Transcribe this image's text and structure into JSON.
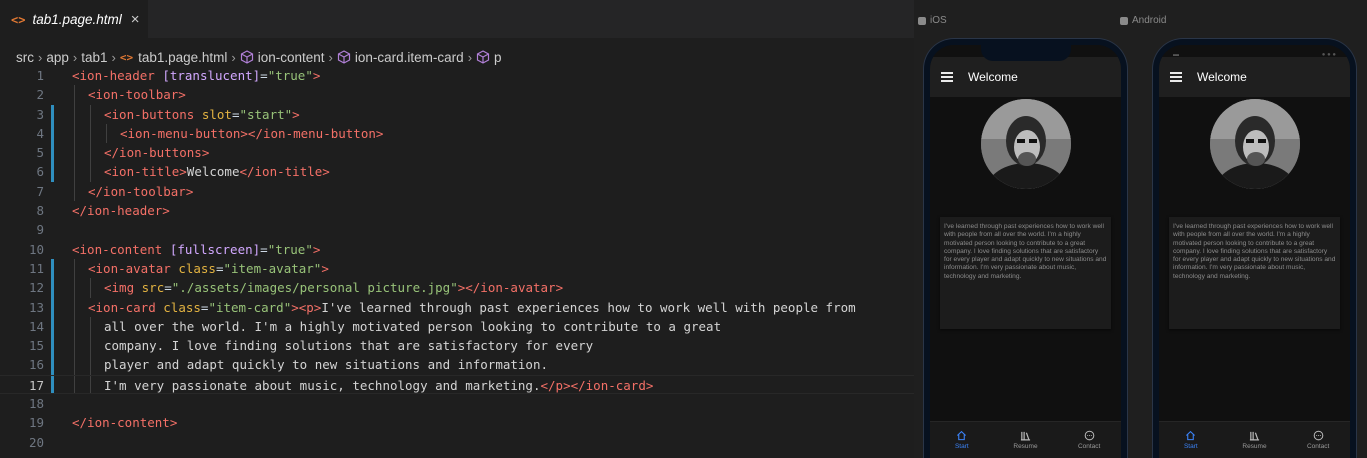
{
  "editor": {
    "tab": {
      "icon": "<>",
      "name": "tab1.page.html",
      "close": "×"
    },
    "breadcrumb": [
      "src",
      "app",
      "tab1",
      "tab1.page.html",
      "ion-content",
      "ion-card.item-card",
      "p"
    ],
    "current_line": 17,
    "lines": [
      {
        "n": "1",
        "indent": 0,
        "tokens": [
          [
            "tag",
            "<ion-header "
          ],
          [
            "attr",
            "[translucent]"
          ],
          [
            "punc",
            "="
          ],
          [
            "str",
            "\"true\""
          ],
          [
            "tag",
            ">"
          ]
        ]
      },
      {
        "n": "2",
        "indent": 1,
        "tokens": [
          [
            "tag",
            "<ion-toolbar>"
          ]
        ]
      },
      {
        "n": "3",
        "indent": 2,
        "tokens": [
          [
            "tag",
            "<ion-buttons "
          ],
          [
            "attr2",
            "slot"
          ],
          [
            "punc",
            "="
          ],
          [
            "str",
            "\"start\""
          ],
          [
            "tag",
            ">"
          ]
        ]
      },
      {
        "n": "4",
        "indent": 3,
        "tokens": [
          [
            "tag",
            "<ion-menu-button></ion-menu-button>"
          ]
        ]
      },
      {
        "n": "5",
        "indent": 2,
        "tokens": [
          [
            "tag",
            "</ion-buttons>"
          ]
        ]
      },
      {
        "n": "6",
        "indent": 2,
        "tokens": [
          [
            "tag",
            "<ion-title>"
          ],
          [
            "text",
            "Welcome"
          ],
          [
            "tag",
            "</ion-title>"
          ]
        ]
      },
      {
        "n": "7",
        "indent": 1,
        "tokens": [
          [
            "tag",
            "</ion-toolbar>"
          ]
        ]
      },
      {
        "n": "8",
        "indent": 0,
        "tokens": [
          [
            "tag",
            "</ion-header>"
          ]
        ]
      },
      {
        "n": "9",
        "indent": 0,
        "tokens": []
      },
      {
        "n": "10",
        "indent": 0,
        "tokens": [
          [
            "tag",
            "<ion-content "
          ],
          [
            "attr",
            "[fullscreen]"
          ],
          [
            "punc",
            "="
          ],
          [
            "str",
            "\"true\""
          ],
          [
            "tag",
            ">"
          ]
        ]
      },
      {
        "n": "11",
        "indent": 1,
        "tokens": [
          [
            "tag",
            "<ion-avatar "
          ],
          [
            "attr2",
            "class"
          ],
          [
            "punc",
            "="
          ],
          [
            "str",
            "\"item-avatar\""
          ],
          [
            "tag",
            ">"
          ]
        ]
      },
      {
        "n": "12",
        "indent": 2,
        "tokens": [
          [
            "tag",
            "<img "
          ],
          [
            "attr2",
            "src"
          ],
          [
            "punc",
            "="
          ],
          [
            "str",
            "\"./assets/images/personal picture.jpg\""
          ],
          [
            "tag",
            "></ion-avatar>"
          ]
        ]
      },
      {
        "n": "13",
        "indent": 1,
        "tokens": [
          [
            "tag",
            "<ion-card "
          ],
          [
            "attr2",
            "class"
          ],
          [
            "punc",
            "="
          ],
          [
            "str",
            "\"item-card\""
          ],
          [
            "tag",
            "><p>"
          ],
          [
            "text",
            "I've learned through past experiences how to work well with people from"
          ]
        ]
      },
      {
        "n": "14",
        "indent": 2,
        "tokens": [
          [
            "text",
            "all over the world. I'm a highly motivated person looking to contribute to a great"
          ]
        ]
      },
      {
        "n": "15",
        "indent": 2,
        "tokens": [
          [
            "text",
            "company. I love finding solutions that are satisfactory for every"
          ]
        ]
      },
      {
        "n": "16",
        "indent": 2,
        "tokens": [
          [
            "text",
            "player and adapt quickly to new situations and information."
          ]
        ]
      },
      {
        "n": "17",
        "indent": 2,
        "tokens": [
          [
            "text",
            "I'm very passionate about music, technology and marketing."
          ],
          [
            "tag",
            "</p></ion-card>"
          ]
        ]
      },
      {
        "n": "18",
        "indent": 0,
        "tokens": []
      },
      {
        "n": "19",
        "indent": 0,
        "tokens": [
          [
            "tag",
            "</ion-content>"
          ]
        ]
      },
      {
        "n": "20",
        "indent": 0,
        "tokens": []
      }
    ]
  },
  "preview": {
    "ios_label": "iOS",
    "android_label": "Android",
    "phone": {
      "title": "Welcome",
      "card_text": "I've learned through past experiences how to work well with people from all over the world. I'm a highly motivated person looking to contribute to a great company. I love finding solutions that are satisfactory for every player and adapt quickly to new situations and information. I'm very passionate about music, technology and marketing.",
      "tabs": [
        {
          "label": "Start",
          "icon": "home-icon",
          "active": true
        },
        {
          "label": "Resume",
          "icon": "library-icon",
          "active": false
        },
        {
          "label": "Contact",
          "icon": "chat-icon",
          "active": false
        }
      ]
    }
  },
  "colors": {
    "tag": "#f47067",
    "attr": "#d2a8ff",
    "string": "#98c379",
    "active_tab": "#3b82f6",
    "scm_bar": "#2f8fbf"
  }
}
